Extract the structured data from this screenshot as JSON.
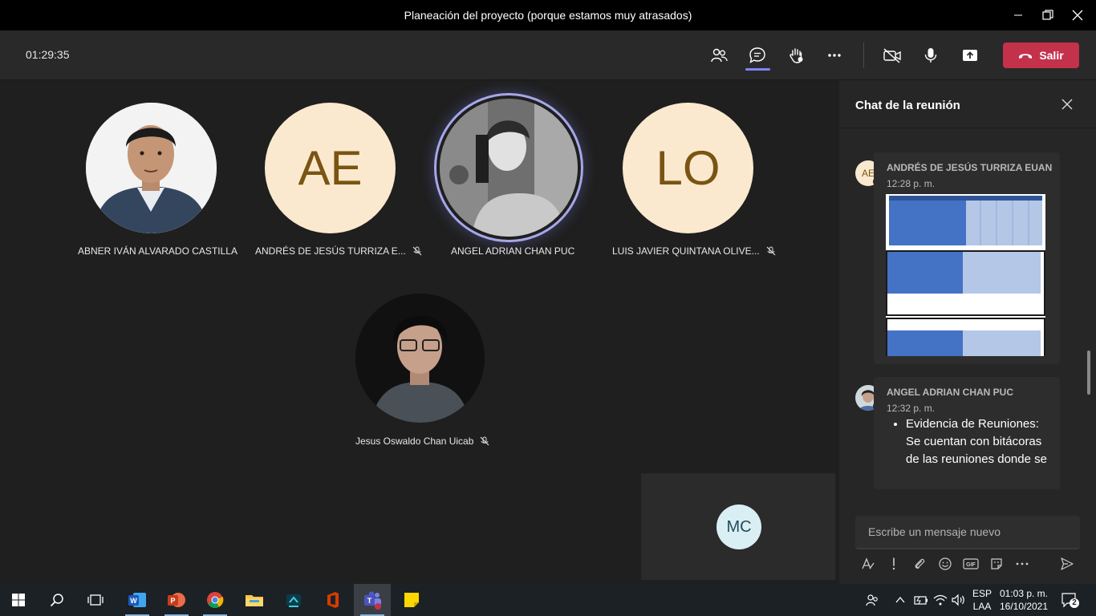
{
  "window": {
    "title": "Planeación del proyecto (porque estamos muy atrasados)"
  },
  "toolbar": {
    "timer": "01:29:35",
    "leave_label": "Salir",
    "leave_color": "#c4314b",
    "accent": "#7f85f5"
  },
  "participants": [
    {
      "name": "ABNER IVÁN ALVARADO CASTILLA",
      "initials": "",
      "muted": false
    },
    {
      "name": "ANDRÉS DE JESÚS TURRIZA E...",
      "initials": "AE",
      "muted": true
    },
    {
      "name": "ANGEL ADRIAN CHAN PUC",
      "initials": "",
      "muted": false,
      "speaking": true
    },
    {
      "name": "LUIS JAVIER QUINTANA OLIVE...",
      "initials": "LO",
      "muted": true
    },
    {
      "name": "Jesus Oswaldo Chan Uicab",
      "initials": "",
      "muted": true
    }
  ],
  "self_tile": {
    "initials": "MC"
  },
  "chat": {
    "title": "Chat de la reunión",
    "messages": [
      {
        "author": "ANDRÉS DE JESÚS TURRIZA EUAN",
        "avatar_initials": "AE",
        "time": "12:28 p. m.",
        "attachment": "document-screenshot"
      },
      {
        "author": "ANGEL ADRIAN CHAN PUC",
        "avatar_initials": "",
        "time": "12:32 p. m.",
        "text": "Evidencia de Reuniones: Se cuentan con bitácoras de las reuniones donde se"
      }
    ],
    "compose_placeholder": "Escribe un mensaje nuevo"
  },
  "taskbar": {
    "lang_top": "ESP",
    "lang_bottom": "LAA",
    "time": "01:03 p. m.",
    "date": "16/10/2021",
    "notifications": "2"
  }
}
